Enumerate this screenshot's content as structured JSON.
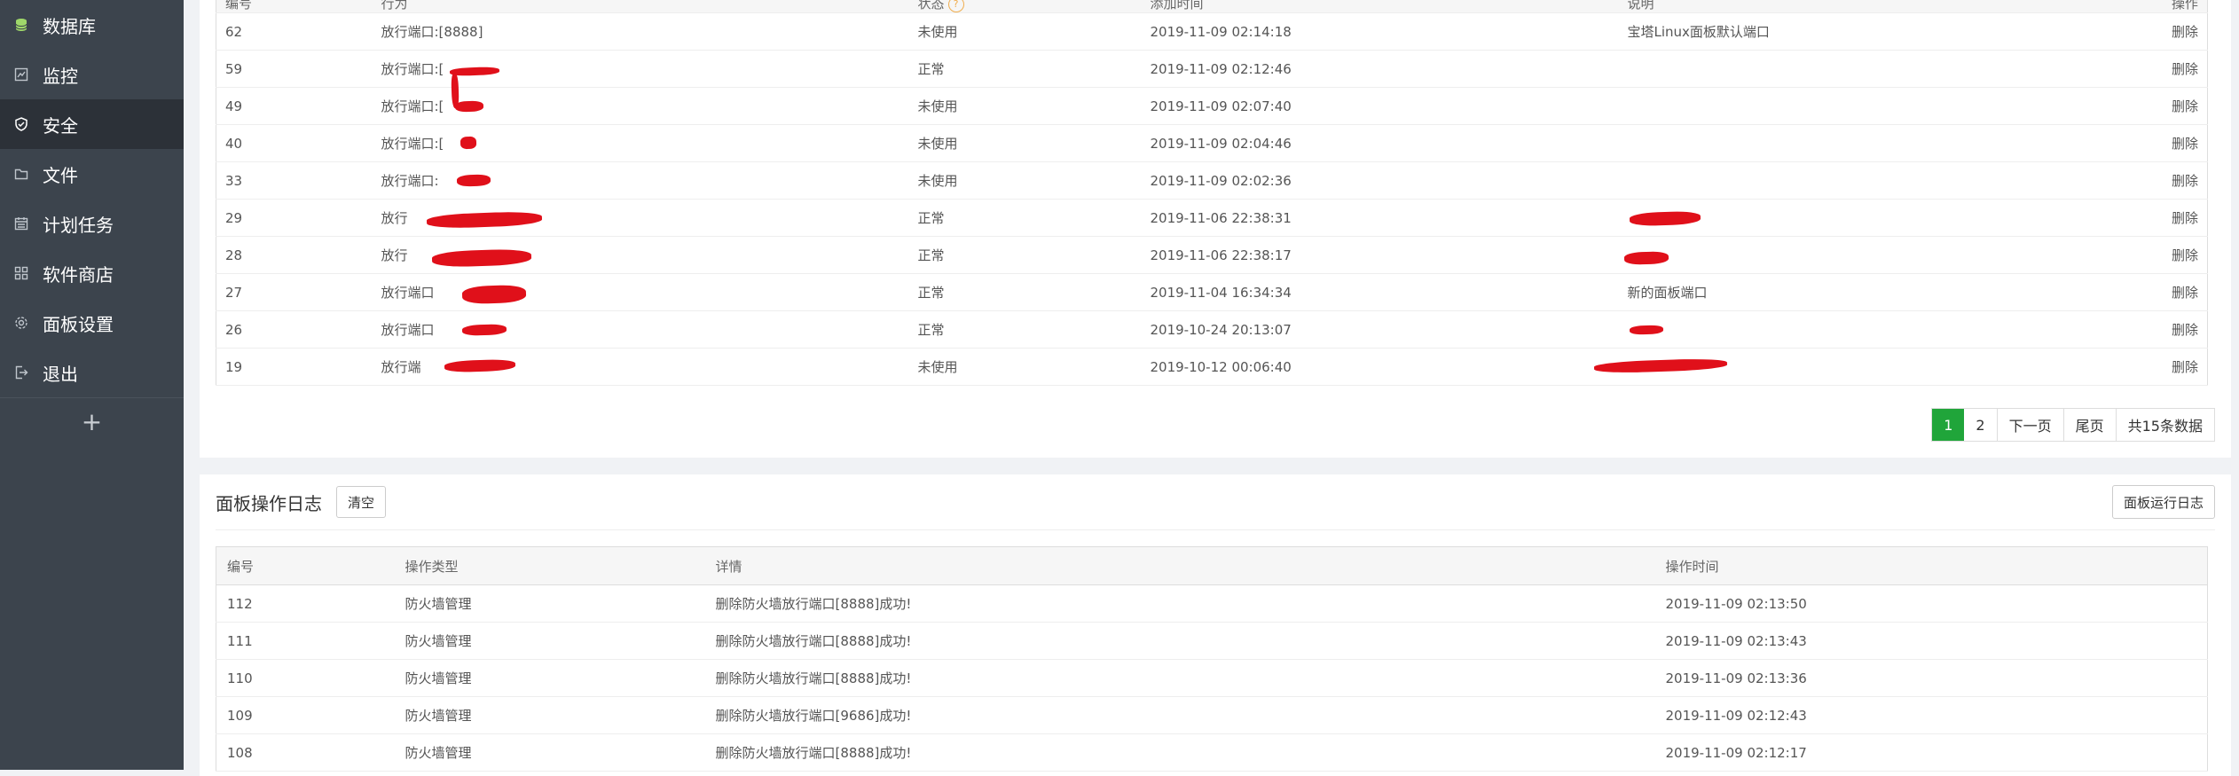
{
  "sidebar": {
    "items": [
      {
        "label": "数据库",
        "icon": "database-icon"
      },
      {
        "label": "监控",
        "icon": "monitor-icon"
      },
      {
        "label": "安全",
        "icon": "shield-icon"
      },
      {
        "label": "文件",
        "icon": "folder-icon"
      },
      {
        "label": "计划任务",
        "icon": "calendar-icon"
      },
      {
        "label": "软件商店",
        "icon": "grid-icon"
      },
      {
        "label": "面板设置",
        "icon": "gear-icon"
      },
      {
        "label": "退出",
        "icon": "logout-icon"
      }
    ],
    "add_label": "+"
  },
  "firewall": {
    "headers": [
      "编号",
      "行为",
      "状态",
      "添加时间",
      "说明",
      "操作"
    ],
    "rows": [
      {
        "id": "62",
        "action": "放行端口:[8888]",
        "status": "未使用",
        "time": "2019-11-09 02:14:18",
        "note": "宝塔Linux面板默认端口",
        "op": "删除"
      },
      {
        "id": "59",
        "action": "放行端口:[",
        "status": "正常",
        "time": "2019-11-09 02:12:46",
        "note": "",
        "op": "删除"
      },
      {
        "id": "49",
        "action": "放行端口:[",
        "status": "未使用",
        "time": "2019-11-09 02:07:40",
        "note": "",
        "op": "删除"
      },
      {
        "id": "40",
        "action": "放行端口:[",
        "status": "未使用",
        "time": "2019-11-09 02:04:46",
        "note": "",
        "op": "删除"
      },
      {
        "id": "33",
        "action": "放行端口:",
        "status": "未使用",
        "time": "2019-11-09 02:02:36",
        "note": "",
        "op": "删除"
      },
      {
        "id": "29",
        "action": "放行",
        "status": "正常",
        "time": "2019-11-06 22:38:31",
        "note": "",
        "op": "删除"
      },
      {
        "id": "28",
        "action": "放行",
        "status": "正常",
        "time": "2019-11-06 22:38:17",
        "note": "",
        "op": "删除"
      },
      {
        "id": "27",
        "action": "放行端口",
        "status": "正常",
        "time": "2019-11-04 16:34:34",
        "note": "新的面板端口",
        "op": "删除"
      },
      {
        "id": "26",
        "action": "放行端口",
        "status": "正常",
        "time": "2019-10-24 20:13:07",
        "note": "",
        "op": "删除"
      },
      {
        "id": "19",
        "action": "放行端",
        "status": "未使用",
        "time": "2019-10-12 00:06:40",
        "note": "",
        "op": "删除"
      }
    ],
    "pager": {
      "current": "1",
      "page2": "2",
      "next": "下一页",
      "last": "尾页",
      "total": "共15条数据"
    }
  },
  "oplog": {
    "title": "面板操作日志",
    "clear_label": "清空",
    "runlog_label": "面板运行日志",
    "headers": [
      "编号",
      "操作类型",
      "详情",
      "操作时间"
    ],
    "rows": [
      {
        "id": "112",
        "type": "防火墙管理",
        "detail": "删除防火墙放行端口[8888]成功!",
        "time": "2019-11-09 02:13:50"
      },
      {
        "id": "111",
        "type": "防火墙管理",
        "detail": "删除防火墙放行端口[8888]成功!",
        "time": "2019-11-09 02:13:43"
      },
      {
        "id": "110",
        "type": "防火墙管理",
        "detail": "删除防火墙放行端口[8888]成功!",
        "time": "2019-11-09 02:13:36"
      },
      {
        "id": "109",
        "type": "防火墙管理",
        "detail": "删除防火墙放行端口[9686]成功!",
        "time": "2019-11-09 02:12:43"
      },
      {
        "id": "108",
        "type": "防火墙管理",
        "detail": "删除防火墙放行端口[8888]成功!",
        "time": "2019-11-09 02:12:17"
      }
    ]
  },
  "colors": {
    "accent": "#20a53a",
    "sidebar": "#3c444d",
    "sidebar_active": "#2c3138",
    "redaction": "#e0101a"
  }
}
